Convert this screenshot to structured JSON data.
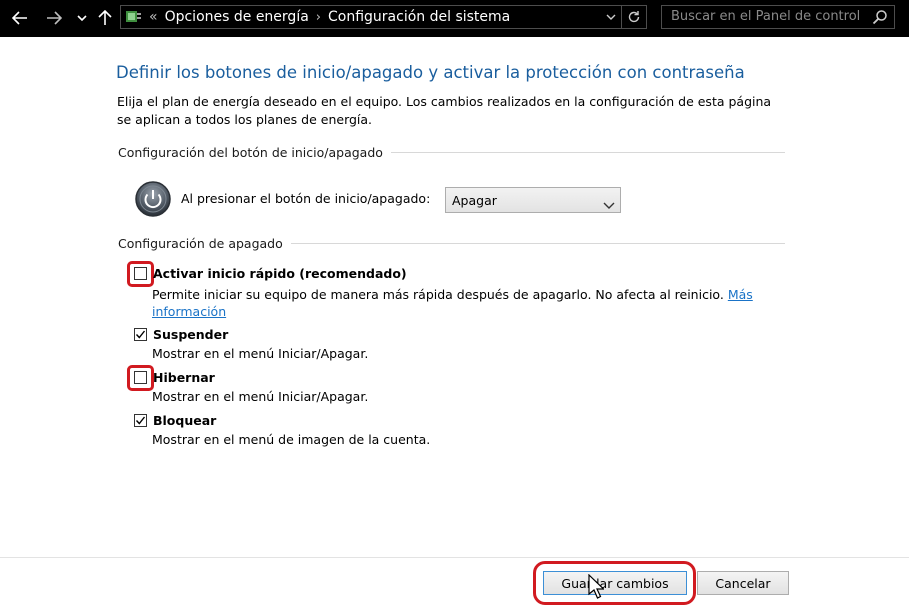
{
  "nav": {
    "breadcrumb": [
      "Opciones de energía",
      "Configuración del sistema"
    ],
    "overflow_glyph": "«",
    "search_placeholder": "Buscar en el Panel de control"
  },
  "page": {
    "title": "Definir los botones de inicio/apagado y activar la protección con contraseña",
    "description": "Elija el plan de energía deseado en el equipo. Los cambios realizados en la configuración de esta página se aplican a todos los planes de energía."
  },
  "power_button_group": {
    "header": "Configuración del botón de inicio/apagado",
    "label": "Al presionar el botón de inicio/apagado:",
    "selected": "Apagar"
  },
  "shutdown_group": {
    "header": "Configuración de apagado",
    "options": [
      {
        "label": "Activar inicio rápido (recomendado)",
        "description": "Permite iniciar su equipo de manera más rápida después de apagarlo. No afecta al reinicio.",
        "link_text_1": "Más",
        "link_text_2": "información",
        "checked": false,
        "highlighted": true
      },
      {
        "label": "Suspender",
        "description": "Mostrar en el menú Iniciar/Apagar.",
        "checked": true,
        "highlighted": false
      },
      {
        "label": "Hibernar",
        "description": "Mostrar en el menú Iniciar/Apagar.",
        "checked": false,
        "highlighted": true
      },
      {
        "label": "Bloquear",
        "description": "Mostrar en el menú de imagen de la cuenta.",
        "checked": true,
        "highlighted": false
      }
    ]
  },
  "buttons": {
    "save": "Guardar cambios",
    "cancel": "Cancelar"
  },
  "colors": {
    "title": "#1a5e9e",
    "highlight": "#d11a20",
    "link": "#1a73c7"
  },
  "icons": [
    "back-arrow-icon",
    "forward-arrow-icon",
    "recent-dropdown-icon",
    "up-arrow-icon",
    "power-options-icon",
    "refresh-icon",
    "search-icon",
    "power-button-icon",
    "chevron-down-icon",
    "checkmark-icon",
    "mouse-cursor-icon"
  ]
}
